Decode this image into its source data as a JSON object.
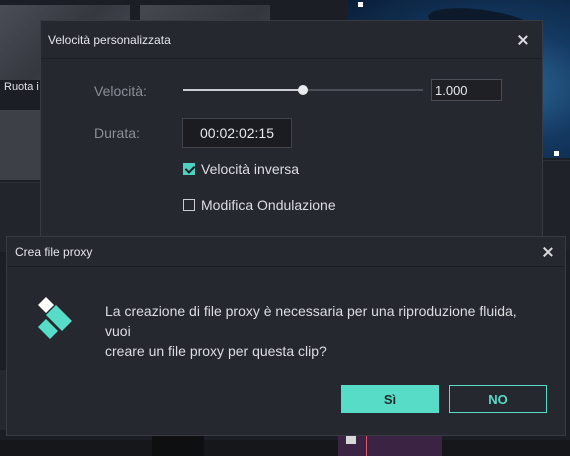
{
  "background": {
    "clip_label": "Ruota i"
  },
  "speed_dialog": {
    "title": "Velocità personalizzata",
    "speed_label": "Velocità:",
    "speed_value": "1.000",
    "speed_slider_fraction": 0.5,
    "duration_label": "Durata:",
    "duration_value": "00:02:02:15",
    "reverse_label": "Velocità inversa",
    "reverse_checked": true,
    "ripple_label": "Modifica Ondulazione",
    "ripple_checked": false
  },
  "proxy_dialog": {
    "title": "Crea file proxy",
    "message_line1": "La creazione di file proxy è necessaria per una riproduzione fluida, vuoi",
    "message_line2": "creare un file proxy per questa clip?",
    "yes_label": "Sì",
    "no_label": "NO"
  },
  "colors": {
    "accent": "#57dcc8",
    "dialog_bg": "#25282f"
  }
}
